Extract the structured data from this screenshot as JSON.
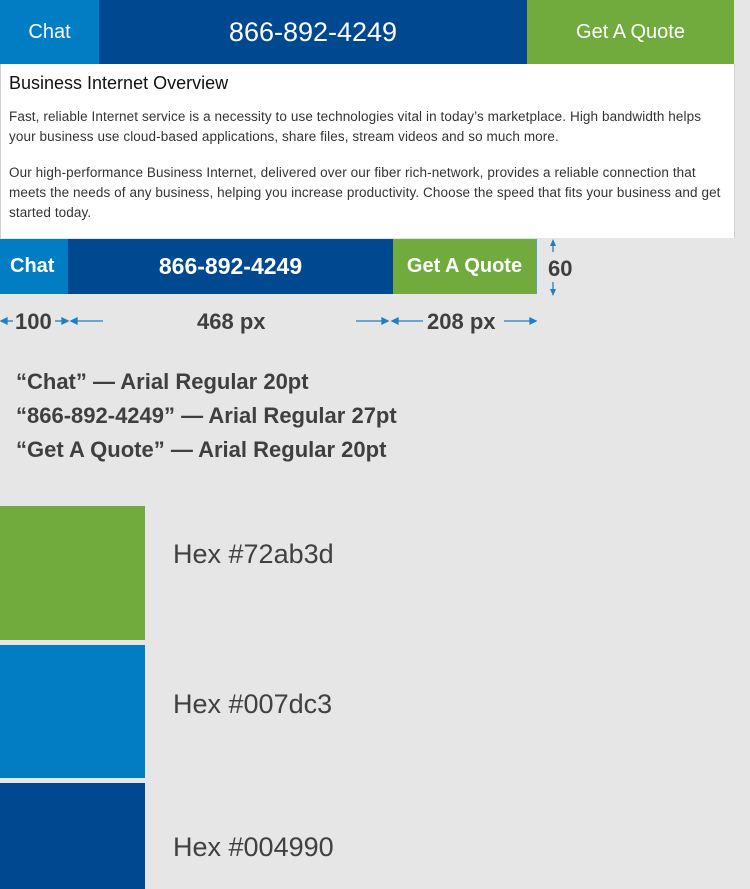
{
  "top_bar": {
    "chat_label": "Chat",
    "phone": "866-892-4249",
    "quote_label": "Get A Quote"
  },
  "overview": {
    "title": "Business Internet Overview",
    "paragraph1": "Fast, reliable Internet service is a necessity to use technologies vital in today’s marketplace. High bandwidth helps your business use cloud-based applications, share files, stream videos and so much more.",
    "paragraph2": "Our high-performance Business Internet, delivered over our fiber rich-network, provides a reliable connection that meets the needs of any business, helping you increase productivity. Choose the speed that fits your business and get started today."
  },
  "spec_bar": {
    "chat_label": "Chat",
    "phone": "866-892-4249",
    "quote_label": "Get A Quote",
    "height_label": "60"
  },
  "dimensions": {
    "chat_width": "100",
    "phone_width": "468 px",
    "quote_width": "208 px"
  },
  "font_specs": [
    "“Chat” — Arial Regular 20pt",
    "“866-892-4249” — Arial Regular 27pt",
    "“Get A Quote” — Arial Regular 20pt"
  ],
  "colors": [
    {
      "hex": "#72ab3d",
      "label": "Hex #72ab3d"
    },
    {
      "hex": "#007dc3",
      "label": "Hex #007dc3"
    },
    {
      "hex": "#004990",
      "label": "Hex #004990"
    }
  ]
}
